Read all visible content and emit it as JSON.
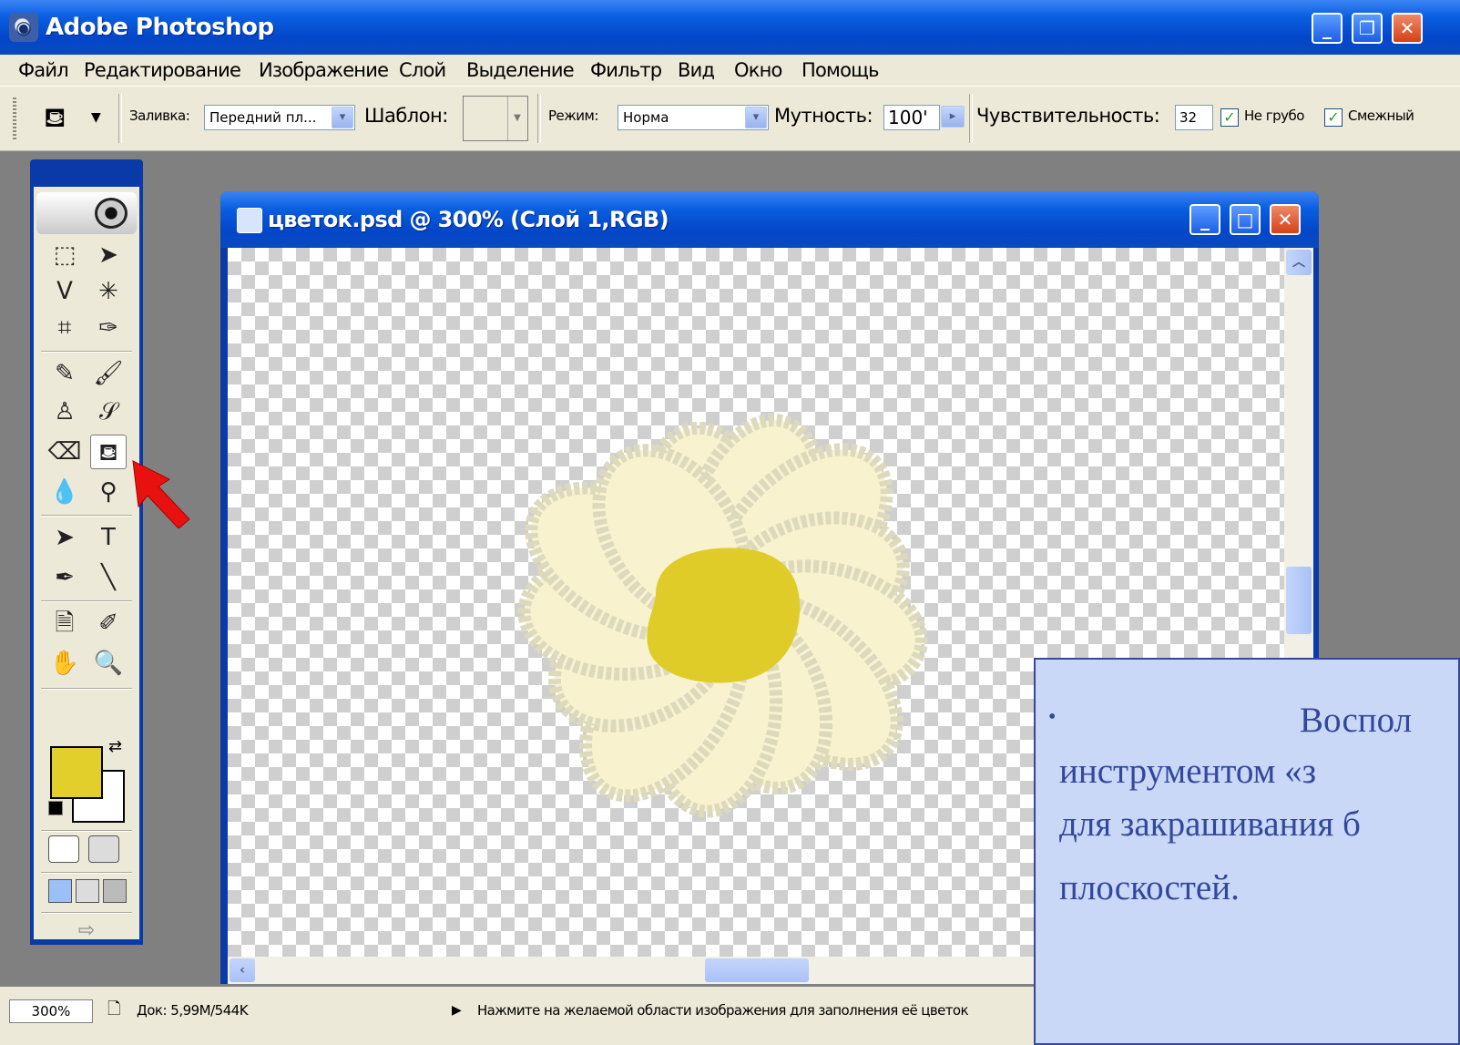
{
  "app": {
    "title": "Adobe Photoshop",
    "icon": "photoshop-eye-icon"
  },
  "menu": [
    "Файл",
    "Редактирование",
    "Изображение",
    "Слой",
    "Выделение",
    "Фильтр",
    "Вид",
    "Окно",
    "Помощь"
  ],
  "options": {
    "fill_label": "Заливка:",
    "fill_value": "Передний пл...",
    "pattern_label": "Шаблон:",
    "mode_label": "Режим:",
    "mode_value": "Норма",
    "opacity_label": "Мутность:",
    "opacity_value": "100'",
    "tolerance_label": "Чувствительность:",
    "tolerance_value": "32",
    "anti_alias_label": "Не грубо",
    "anti_alias_checked": true,
    "contiguous_label": "Смежный",
    "contiguous_checked": true
  },
  "toolbox": {
    "foreground_color": "#e2cf2c",
    "background_color": "#ffffff",
    "active_tool": "paint-bucket"
  },
  "document": {
    "title": "цветок.psd @ 300% (Слой 1,RGB)",
    "petal_color": "#f8f2cf",
    "petal_outline_color": "#ddd9bd",
    "center_color": "#e0cc28"
  },
  "status": {
    "zoom": "300%",
    "doc_size": "Док: 5,99M/544K",
    "hint": "Нажмите на желаемой области изображения для заполнения её цветок"
  },
  "note": {
    "bullet": "•",
    "line1": "Воспол",
    "line2": "инструментом      «з",
    "line3": "для закрашивания б",
    "line4": "плоскостей."
  },
  "colors": {
    "annotation_arrow": "#e8110f",
    "xp_blue": "#0a5fe0"
  }
}
